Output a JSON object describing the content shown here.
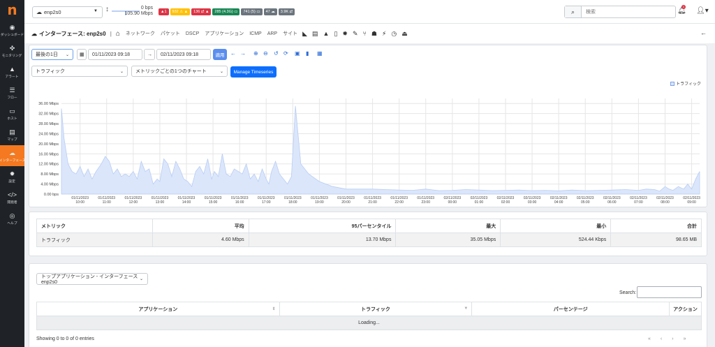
{
  "app": {
    "logo": "n"
  },
  "sidebar": {
    "items": [
      {
        "label": "ダッシュボード",
        "icon": "gauge-icon",
        "glyph": "◉"
      },
      {
        "label": "モニタリング",
        "icon": "monitor-icon",
        "glyph": "✜"
      },
      {
        "label": "アラート",
        "icon": "alert-icon",
        "glyph": "▲"
      },
      {
        "label": "フロー",
        "icon": "flow-icon",
        "glyph": "☰"
      },
      {
        "label": "ホスト",
        "icon": "laptop-icon",
        "glyph": "▭"
      },
      {
        "label": "マップ",
        "icon": "map-icon",
        "glyph": "▤"
      },
      {
        "label": "インターフェース",
        "icon": "ethernet-icon",
        "glyph": "☁",
        "active": true
      },
      {
        "label": "設定",
        "icon": "gear-icon",
        "glyph": "✹"
      },
      {
        "label": "開発者",
        "icon": "code-icon",
        "glyph": "</>"
      },
      {
        "label": "ヘルプ",
        "icon": "lifebuoy-icon",
        "glyph": "◎"
      }
    ]
  },
  "topbar": {
    "interface": "enp2s0",
    "rate_top": "0 bps",
    "rate_bottom": "105.90 Mbps",
    "badges": [
      {
        "text": "▲1",
        "color": "#dc3545"
      },
      {
        "text": "932 ⚠ ▲",
        "color": "#ffc107"
      },
      {
        "text": "136 ⇄ ▲",
        "color": "#dc3545"
      },
      {
        "text": "285 (4.3G) ▭",
        "color": "#198754"
      },
      {
        "text": "741 (5) ▭",
        "color": "#6c757d"
      },
      {
        "text": "47 ☁",
        "color": "#6c757d"
      },
      {
        "text": "3.9K ⇄",
        "color": "#6c757d"
      }
    ],
    "search_placeholder": "検索",
    "notification_count": "1"
  },
  "subhead": {
    "title": "インターフェース: enp2s0",
    "links": [
      "ネットワーク",
      "パケット",
      "DSCP",
      "アプリケーション",
      "ICMP",
      "ARP",
      "サイト"
    ]
  },
  "controls": {
    "range": "最後の1日",
    "date_from": "01/11/2023 09:18",
    "date_to": "02/11/2023 09:18",
    "apply": "適用",
    "metric": "トラフィック",
    "chart_mode": "メトリックごとの1つのチャート",
    "timeseries_btn": "Manage Timeseries"
  },
  "chart_data": {
    "type": "area",
    "legend": [
      "トラフィック"
    ],
    "legend_position": "top-right",
    "ylabel": "",
    "ylim": [
      0,
      38
    ],
    "y_ticks": [
      "0.00 bps",
      "4.00 Mbps",
      "8.00 Mbps",
      "12.00 Mbps",
      "16.00 Mbps",
      "20.00 Mbps",
      "24.00 Mbps",
      "28.00 Mbps",
      "32.00 Mbps",
      "36.00 Mbps"
    ],
    "x_ticks": [
      [
        "01/11/2023",
        "10:00"
      ],
      [
        "01/11/2023",
        "11:00"
      ],
      [
        "01/11/2023",
        "12:00"
      ],
      [
        "01/11/2023",
        "13:00"
      ],
      [
        "01/11/2023",
        "14:00"
      ],
      [
        "01/11/2023",
        "15:00"
      ],
      [
        "01/11/2023",
        "16:00"
      ],
      [
        "01/11/2023",
        "17:00"
      ],
      [
        "01/11/2023",
        "18:00"
      ],
      [
        "01/11/2023",
        "19:00"
      ],
      [
        "01/11/2023",
        "20:00"
      ],
      [
        "01/11/2023",
        "21:00"
      ],
      [
        "01/11/2023",
        "22:00"
      ],
      [
        "01/11/2023",
        "23:00"
      ],
      [
        "02/11/2023",
        "00:00"
      ],
      [
        "02/11/2023",
        "01:00"
      ],
      [
        "02/11/2023",
        "02:00"
      ],
      [
        "02/11/2023",
        "03:00"
      ],
      [
        "02/11/2023",
        "04:00"
      ],
      [
        "02/11/2023",
        "05:00"
      ],
      [
        "02/11/2023",
        "06:00"
      ],
      [
        "02/11/2023",
        "07:00"
      ],
      [
        "02/11/2023",
        "08:00"
      ],
      [
        "02/11/2023",
        "09:00"
      ]
    ],
    "series": [
      {
        "name": "トラフィック",
        "unit": "Mbps",
        "x_hours": [
          9.3,
          9.4,
          9.55,
          9.7,
          9.85,
          10,
          10.15,
          10.3,
          10.45,
          10.6,
          10.8,
          10.95,
          11.1,
          11.25,
          11.4,
          11.55,
          11.7,
          11.85,
          12,
          12.15,
          12.3,
          12.45,
          12.6,
          12.75,
          12.9,
          13,
          13.15,
          13.3,
          13.45,
          13.6,
          13.75,
          13.9,
          14.05,
          14.2,
          14.35,
          14.5,
          14.65,
          14.8,
          14.95,
          15.05,
          15.2,
          15.35,
          15.5,
          15.65,
          15.8,
          15.95,
          16.1,
          16.25,
          16.4,
          16.55,
          16.7,
          16.85,
          17,
          17.1,
          17.2,
          17.35,
          17.5,
          17.65,
          17.8,
          17.95,
          18.1,
          18.3,
          18.6,
          19,
          19.5,
          20,
          20.5,
          21,
          21.5,
          22,
          22.5,
          23,
          23.5,
          24,
          24.5,
          25,
          25.5,
          26,
          26.5,
          27,
          27.5,
          28,
          28.5,
          29,
          29.5,
          30,
          30.5,
          31,
          31.3,
          31.6,
          31.8,
          32,
          32.15,
          32.3,
          32.5,
          32.7,
          32.85,
          33,
          33.15,
          33.3
        ],
        "values": [
          34,
          22,
          12,
          9,
          8,
          11,
          7,
          10,
          6,
          9,
          12,
          15,
          13,
          8,
          10,
          7,
          8,
          7,
          9,
          6,
          13,
          9,
          10,
          4,
          6,
          5,
          14,
          12,
          7,
          13,
          10,
          6,
          5,
          3,
          9,
          11,
          8,
          14,
          6,
          9,
          7,
          16,
          8,
          7,
          10,
          9,
          8,
          12,
          6,
          8,
          5,
          10,
          6,
          4,
          9,
          13,
          8,
          6,
          4,
          7,
          35,
          12,
          8,
          5,
          3,
          2,
          2,
          2,
          1.8,
          1.6,
          1.5,
          2,
          1.4,
          1.5,
          1.8,
          1.6,
          1.4,
          1.5,
          1.6,
          1.4,
          1.5,
          1.3,
          1.6,
          1.4,
          1.5,
          1.6,
          1.8,
          1.5,
          2,
          1.8,
          1.2,
          3,
          2,
          1.5,
          3,
          2,
          4,
          2,
          6,
          9
        ]
      }
    ]
  },
  "stats": {
    "headers": [
      "メトリック",
      "平均",
      "95パーセンタイル",
      "最大",
      "最小",
      "合計"
    ],
    "row": [
      "トラフィック",
      "4.60 Mbps",
      "13.70 Mbps",
      "35.05 Mbps",
      "524.44 Kbps",
      "98.65 MB"
    ]
  },
  "apps": {
    "dropdown": "トップアプリケーション - インターフェース enp2s0",
    "search_label": "Search:",
    "headers": [
      "アプリケーション",
      "トラフィック",
      "パーセンテージ",
      "アクション"
    ],
    "loading": "Loading...",
    "showing": "Showing 0 to 0 of 0 entries",
    "pager": [
      "«",
      "‹",
      "›",
      "»"
    ]
  }
}
